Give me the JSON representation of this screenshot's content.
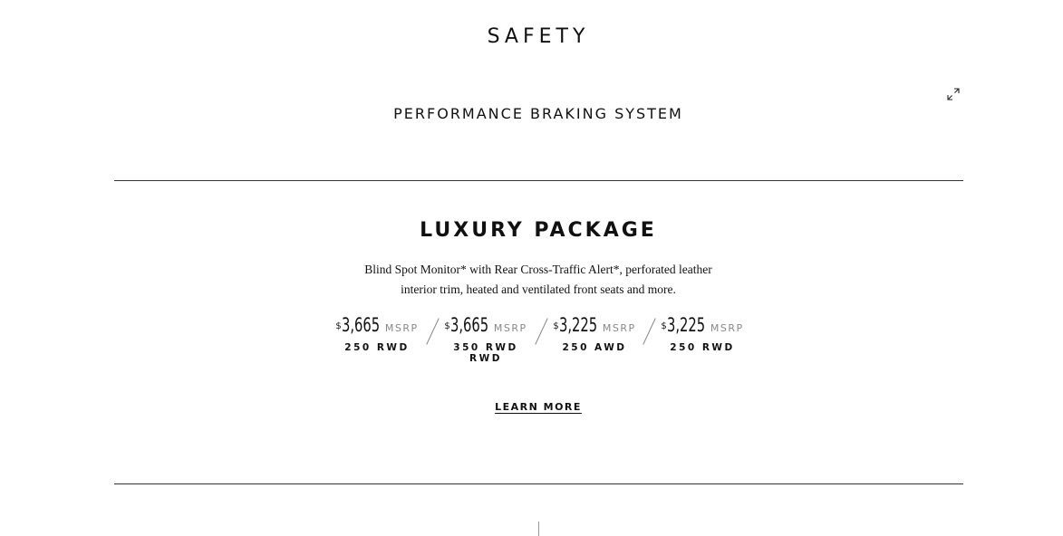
{
  "safety": {
    "title": "SAFETY",
    "feature": "PERFORMANCE BRAKING SYSTEM",
    "expand_icon": "expand-icon"
  },
  "package": {
    "title": "LUXURY PACKAGE",
    "description_line1": "Blind Spot Monitor* with Rear Cross-Traffic Alert*, perforated leather",
    "description_line2": "interior trim, heated and ventilated front seats and more.",
    "prices": [
      {
        "currency": "$",
        "amount": "3,665",
        "label": "MSRP",
        "trim": "250 RWD"
      },
      {
        "currency": "$",
        "amount": "3,665",
        "label": "MSRP",
        "trim": "350 RWD RWD"
      },
      {
        "currency": "$",
        "amount": "3,225",
        "label": "MSRP",
        "trim": "250 AWD"
      },
      {
        "currency": "$",
        "amount": "3,225",
        "label": "MSRP",
        "trim": "250 RWD"
      }
    ],
    "learn_more": "LEARN MORE"
  }
}
